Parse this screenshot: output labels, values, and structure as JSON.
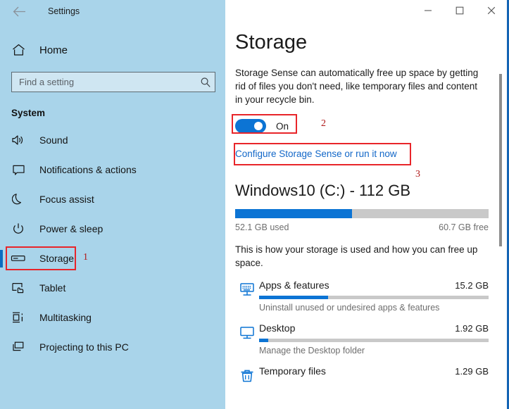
{
  "sidebar": {
    "back_icon": "back-arrow-icon",
    "title": "Settings",
    "home": {
      "label": "Home",
      "icon": "home-icon"
    },
    "search": {
      "placeholder": "Find a setting",
      "value": "",
      "icon": "search-icon"
    },
    "section_heading": "System",
    "items": [
      {
        "label": "Sound",
        "icon": "speaker-icon",
        "selected": false
      },
      {
        "label": "Notifications & actions",
        "icon": "notification-icon",
        "selected": false
      },
      {
        "label": "Focus assist",
        "icon": "moon-icon",
        "selected": false
      },
      {
        "label": "Power & sleep",
        "icon": "power-icon",
        "selected": false
      },
      {
        "label": "Storage",
        "icon": "storage-drive-icon",
        "selected": true
      },
      {
        "label": "Tablet",
        "icon": "tablet-icon",
        "selected": false
      },
      {
        "label": "Multitasking",
        "icon": "multitasking-icon",
        "selected": false
      },
      {
        "label": "Projecting to this PC",
        "icon": "projecting-icon",
        "selected": false
      }
    ]
  },
  "titlebar": {
    "minimize_icon": "minimize-icon",
    "maximize_icon": "maximize-icon",
    "close_icon": "close-icon"
  },
  "main": {
    "page_title": "Storage",
    "storage_sense": {
      "description": "Storage Sense can automatically free up space by getting rid of files you don't need, like temporary files and content in your recycle bin.",
      "toggle_state": "On",
      "toggle_on": true,
      "configure_link": "Configure Storage Sense or run it now"
    },
    "drive": {
      "title": "Windows10 (C:) - 112 GB",
      "used_label": "52.1 GB used",
      "free_label": "60.7 GB free",
      "used_percent": 46
    },
    "howto_text": "This is how your storage is used and how you can free up space.",
    "categories": [
      {
        "name": "Apps & features",
        "size": "15.2 GB",
        "subtitle": "Uninstall unused or undesired apps & features",
        "percent": 30,
        "icon": "apps-features-icon"
      },
      {
        "name": "Desktop",
        "size": "1.92 GB",
        "subtitle": "Manage the Desktop folder",
        "percent": 4,
        "icon": "desktop-monitor-icon"
      },
      {
        "name": "Temporary files",
        "size": "1.29 GB",
        "subtitle": "",
        "percent": 3,
        "icon": "recycle-bin-icon"
      }
    ]
  },
  "annotations": [
    {
      "number": "1",
      "target": "storage-sidebar-item"
    },
    {
      "number": "2",
      "target": "storage-sense-toggle"
    },
    {
      "number": "3",
      "target": "configure-storage-sense-link"
    }
  ],
  "colors": {
    "sidebar_bg": "#a9d4ea",
    "accent_blue": "#0c74d4",
    "link_blue": "#1267c8",
    "annotation_red": "#e8252a",
    "annotation_number_red": "#b01818",
    "track_gray": "#c9c9c9"
  }
}
